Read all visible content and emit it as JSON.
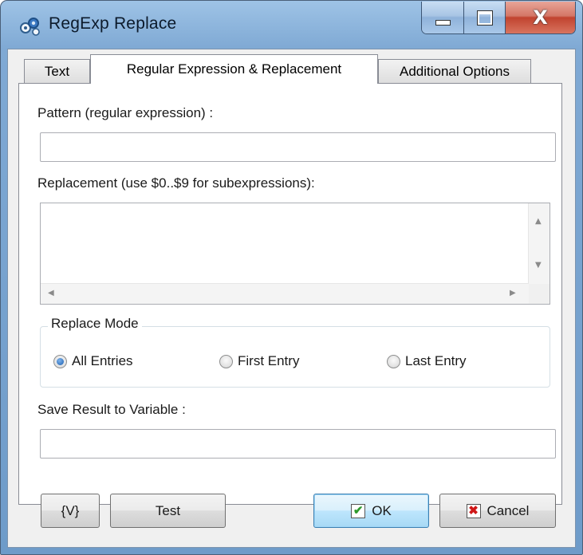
{
  "window": {
    "title": "RegExp Replace",
    "controls": {
      "minimize_icon": "minimize-icon",
      "maximize_icon": "maximize-icon",
      "close_label": "X"
    }
  },
  "tabs": [
    {
      "label": "Text",
      "active": false
    },
    {
      "label": "Regular Expression & Replacement",
      "active": true
    },
    {
      "label": "Additional Options",
      "active": false
    }
  ],
  "form": {
    "pattern_label": "Pattern (regular expression) :",
    "pattern_value": "",
    "replacement_label": "Replacement (use $0..$9 for subexpressions):",
    "replacement_value": "",
    "replace_mode": {
      "title": "Replace Mode",
      "options": [
        {
          "label": "All Entries",
          "selected": true
        },
        {
          "label": "First Entry",
          "selected": false
        },
        {
          "label": "Last Entry",
          "selected": false
        }
      ]
    },
    "save_label": "Save Result to Variable :",
    "save_value": ""
  },
  "buttons": {
    "variable": "{V}",
    "test": "Test",
    "ok": "OK",
    "cancel": "Cancel"
  },
  "colors": {
    "accent": "#3c7fb1",
    "ok_check": "#2e9a2e",
    "cancel_x": "#d01818",
    "close_button": "#c1432f"
  }
}
